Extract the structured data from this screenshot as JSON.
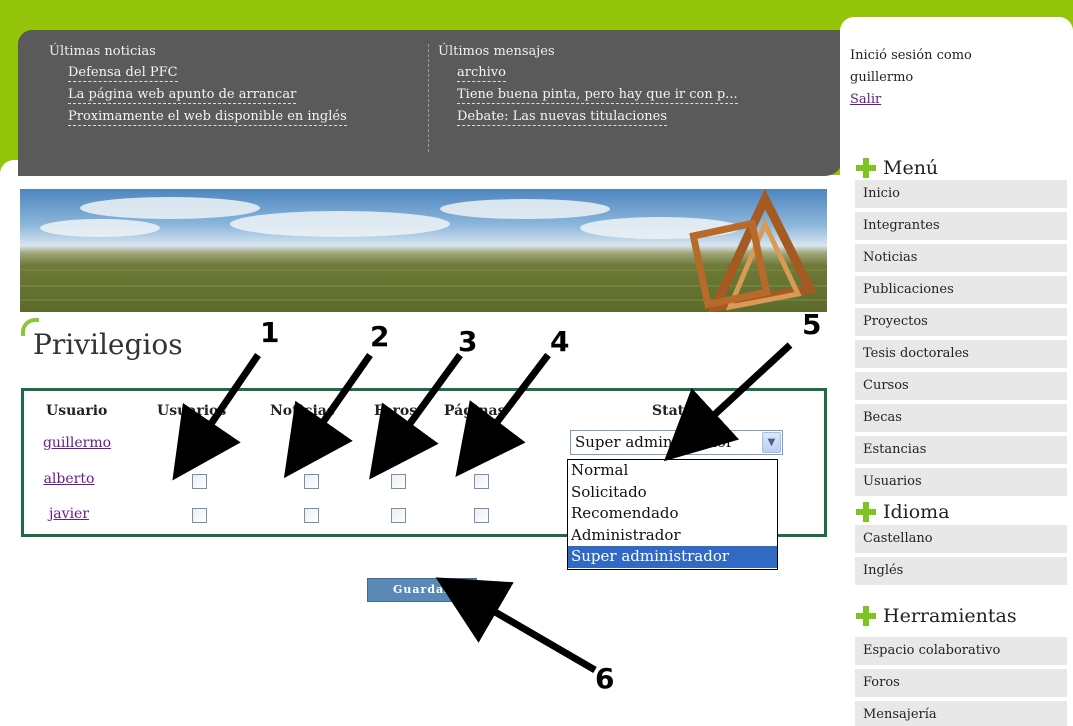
{
  "news": {
    "left_title": "Últimas noticias",
    "left_items": [
      "Defensa del PFC",
      "La página web apunto de arrancar",
      "Proximamente el web disponible en inglés"
    ],
    "right_title": "Últimos mensajes",
    "right_items": [
      "archivo",
      "Tiene buena pinta, pero hay que ir con p...",
      "Debate: Las nuevas titulaciones"
    ]
  },
  "session": {
    "line1": "Inició sesión como",
    "user": "guillermo",
    "logout": "Salir"
  },
  "menu": {
    "title": "Menú",
    "items": [
      "Inicio",
      "Integrantes",
      "Noticias",
      "Publicaciones",
      "Proyectos",
      "Tesis doctorales",
      "Cursos",
      "Becas",
      "Estancias",
      "Usuarios"
    ]
  },
  "language": {
    "title": "Idioma",
    "items": [
      "Castellano",
      "Inglés"
    ]
  },
  "tools": {
    "title": "Herramientas",
    "items": [
      "Espacio colaborativo",
      "Foros",
      "Mensajería"
    ]
  },
  "privileges": {
    "title": "Privilegios",
    "headers": [
      "Usuario",
      "Usuarios",
      "Noticias",
      "Foros",
      "Páginas",
      "Status"
    ],
    "users": [
      {
        "name": "guillermo",
        "checks": [
          true,
          false,
          true,
          false
        ]
      },
      {
        "name": "alberto",
        "checks": [
          false,
          false,
          false,
          false
        ]
      },
      {
        "name": "javier",
        "checks": [
          false,
          false,
          false,
          false
        ]
      }
    ],
    "status_value": "Super administrador",
    "status_options": [
      "Normal",
      "Solicitado",
      "Recomendado",
      "Administrador",
      "Super administrador"
    ],
    "save_label": "Guardar"
  },
  "annotations": [
    "1",
    "2",
    "3",
    "4",
    "5",
    "6"
  ],
  "colors": {
    "page_bg": "#94c40a",
    "news_panel": "#5a5a5a",
    "frame_border": "#1f6b45",
    "button": "#5b89b6",
    "link": "#6a1b8a",
    "select_highlight": "#316ac5"
  }
}
